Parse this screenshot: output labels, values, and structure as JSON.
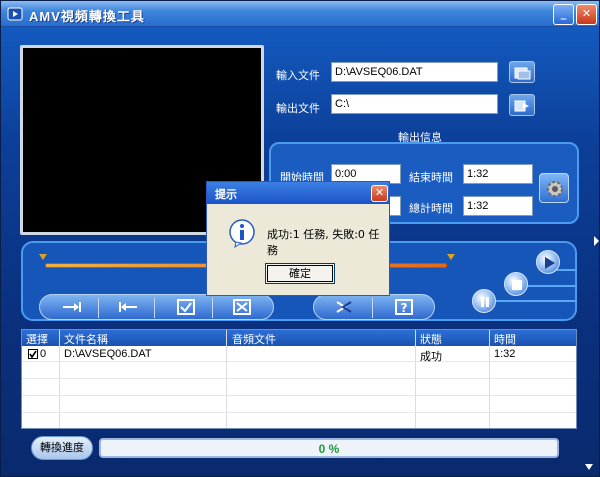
{
  "window": {
    "title": "AMV視頻轉換工具",
    "min_label": "_",
    "close_label": "✕"
  },
  "io": {
    "input_label": "輸入文件",
    "input_value": "D:\\AVSEQ06.DAT",
    "output_label": "輸出文件",
    "output_value": "C:\\"
  },
  "info": {
    "heading": "輸出信息",
    "start_label": "開始時間",
    "start_value": "0:00",
    "end_label": "結束時間",
    "end_value": "1:32",
    "total_label": "總計時間",
    "total_value": "1:32"
  },
  "list": {
    "columns": [
      "選擇",
      "文件名稱",
      "音頻文件",
      "狀態",
      "時間"
    ],
    "rows": [
      {
        "index": "0",
        "file": "D:\\AVSEQ06.DAT",
        "audio": "",
        "status": "成功",
        "time": "1:32",
        "checked": true
      }
    ]
  },
  "progress": {
    "button_label": "轉換進度",
    "value": 0,
    "text": "0 %"
  },
  "dialog": {
    "title": "提示",
    "message": "成功:1 任務, 失敗:0 任務",
    "ok_label": "確定"
  },
  "icons": {
    "open_input": "folder-open-icon",
    "open_output": "export-icon",
    "settings": "gear-icon",
    "info": "info-icon"
  },
  "colors": {
    "window_bg": "#0a2f7c",
    "accent": "#4a9cf0",
    "progress_text": "#1c9a38"
  }
}
